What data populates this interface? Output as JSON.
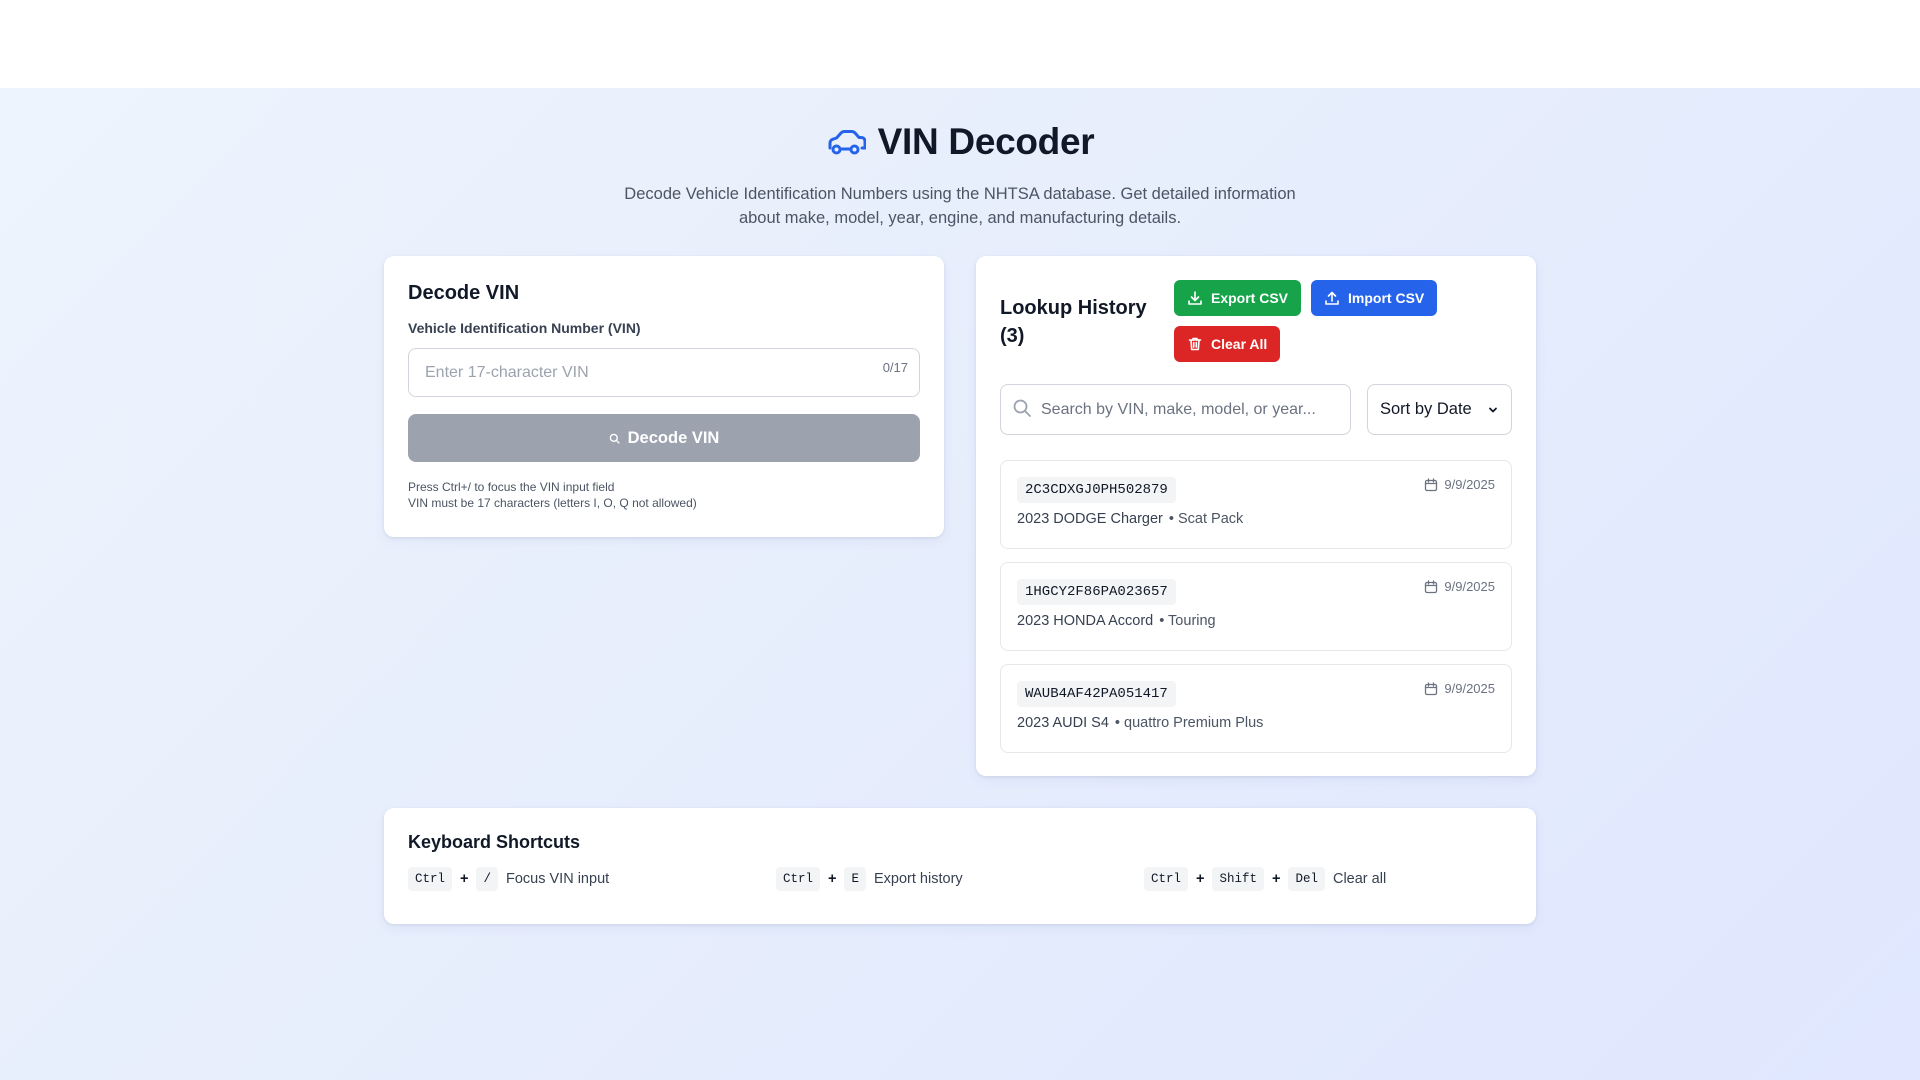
{
  "header": {
    "title": "VIN Decoder",
    "subtitle": "Decode Vehicle Identification Numbers using the NHTSA database. Get detailed information about make, model, year, engine, and manufacturing details.",
    "icon": "car-icon",
    "accent": "#2563eb"
  },
  "decode": {
    "heading": "Decode VIN",
    "field_label": "Vehicle Identification Number (VIN)",
    "input_value": "",
    "input_placeholder": "Enter 17-character VIN",
    "counter": "0/17",
    "button_label": "Decode VIN",
    "hint_1": "Press Ctrl+/ to focus the VIN input field",
    "hint_2": "VIN must be 17 characters (letters I, O, Q not allowed)"
  },
  "history": {
    "title": "Lookup History (3)",
    "export_label": "Export CSV",
    "import_label": "Import CSV",
    "clear_label": "Clear All",
    "search_placeholder": "Search by VIN, make, model, or year...",
    "sort_selected": "Sort by Date",
    "items": [
      {
        "vin": "2C3CDXGJ0PH502879",
        "vehicle": "2023 DODGE Charger",
        "trim": "• Scat Pack",
        "date": "9/9/2025"
      },
      {
        "vin": "1HGCY2F86PA023657",
        "vehicle": "2023 HONDA Accord",
        "trim": "• Touring",
        "date": "9/9/2025"
      },
      {
        "vin": "WAUB4AF42PA051417",
        "vehicle": "2023 AUDI S4",
        "trim": "• quattro Premium Plus",
        "date": "9/9/2025"
      }
    ]
  },
  "shortcuts": {
    "heading": "Keyboard Shortcuts",
    "items": [
      {
        "keys": [
          "Ctrl",
          "/"
        ],
        "label": "Focus VIN input"
      },
      {
        "keys": [
          "Ctrl",
          "E"
        ],
        "label": "Export history"
      },
      {
        "keys": [
          "Ctrl",
          "Shift",
          "Del"
        ],
        "label": "Clear all"
      }
    ],
    "plus": "+"
  },
  "colors": {
    "export": "#16a34a",
    "import": "#2563eb",
    "clear": "#dc2626",
    "decode_disabled": "#9ca3af"
  }
}
